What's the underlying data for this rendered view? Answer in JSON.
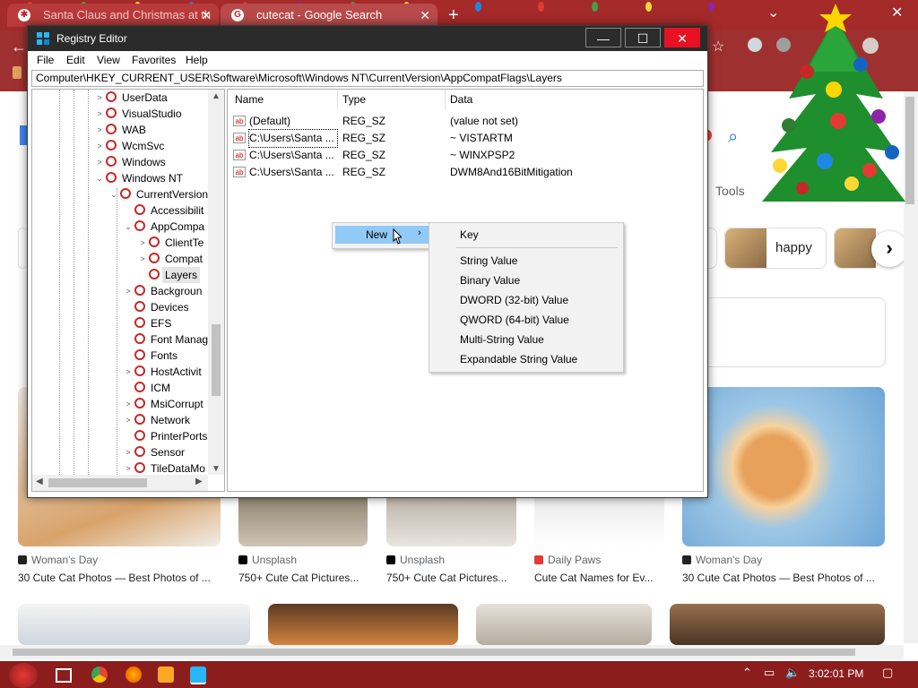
{
  "browser": {
    "tabs": [
      {
        "title": "Santa Claus and Christmas at th",
        "close": "✕"
      },
      {
        "title": "cutecat - Google Search",
        "close": "✕"
      }
    ],
    "new_tab": "+",
    "tools": "Tools",
    "chips": [
      "happy"
    ],
    "results": [
      {
        "source": "Woman's Day",
        "title": "30 Cute Cat Photos — Best Photos of ..."
      },
      {
        "source": "Unsplash",
        "title": "750+ Cute Cat Pictures..."
      },
      {
        "source": "Unsplash",
        "title": "750+ Cute Cat Pictures..."
      },
      {
        "source": "Daily Paws",
        "title": "Cute Cat Names for Ev..."
      },
      {
        "source": "Woman's Day",
        "title": "30 Cute Cat Photos — Best Photos of ..."
      }
    ]
  },
  "regedit": {
    "title": "Registry Editor",
    "menu": [
      "File",
      "Edit",
      "View",
      "Favorites",
      "Help"
    ],
    "address": "Computer\\HKEY_CURRENT_USER\\Software\\Microsoft\\Windows NT\\CurrentVersion\\AppCompatFlags\\Layers",
    "tree": [
      "UserData",
      "VisualStudio",
      "WAB",
      "WcmSvc",
      "Windows",
      "Windows NT",
      "CurrentVersion",
      "Accessibilit",
      "AppCompa",
      "ClientTe",
      "Compat",
      "Layers",
      "Backgroun",
      "Devices",
      "EFS",
      "Font Manag",
      "Fonts",
      "HostActivit",
      "ICM",
      "MsiCorrupt",
      "Network",
      "PrinterPorts",
      "Sensor",
      "TileDataMo"
    ],
    "columns": {
      "name": "Name",
      "type": "Type",
      "data": "Data"
    },
    "values": [
      {
        "name": "(Default)",
        "type": "REG_SZ",
        "data": "(value not set)"
      },
      {
        "name": "C:\\Users\\Santa ...",
        "type": "REG_SZ",
        "data": "~ VISTARTM"
      },
      {
        "name": "C:\\Users\\Santa ...",
        "type": "REG_SZ",
        "data": "~ WINXPSP2"
      },
      {
        "name": "C:\\Users\\Santa ...",
        "type": "REG_SZ",
        "data": "DWM8And16BitMitigation"
      }
    ]
  },
  "context_menu": {
    "new_label": "New",
    "submenu": [
      "Key",
      "String Value",
      "Binary Value",
      "DWORD (32-bit) Value",
      "QWORD (64-bit) Value",
      "Multi-String Value",
      "Expandable String Value"
    ]
  },
  "taskbar": {
    "clock": "3:02:01 PM"
  }
}
